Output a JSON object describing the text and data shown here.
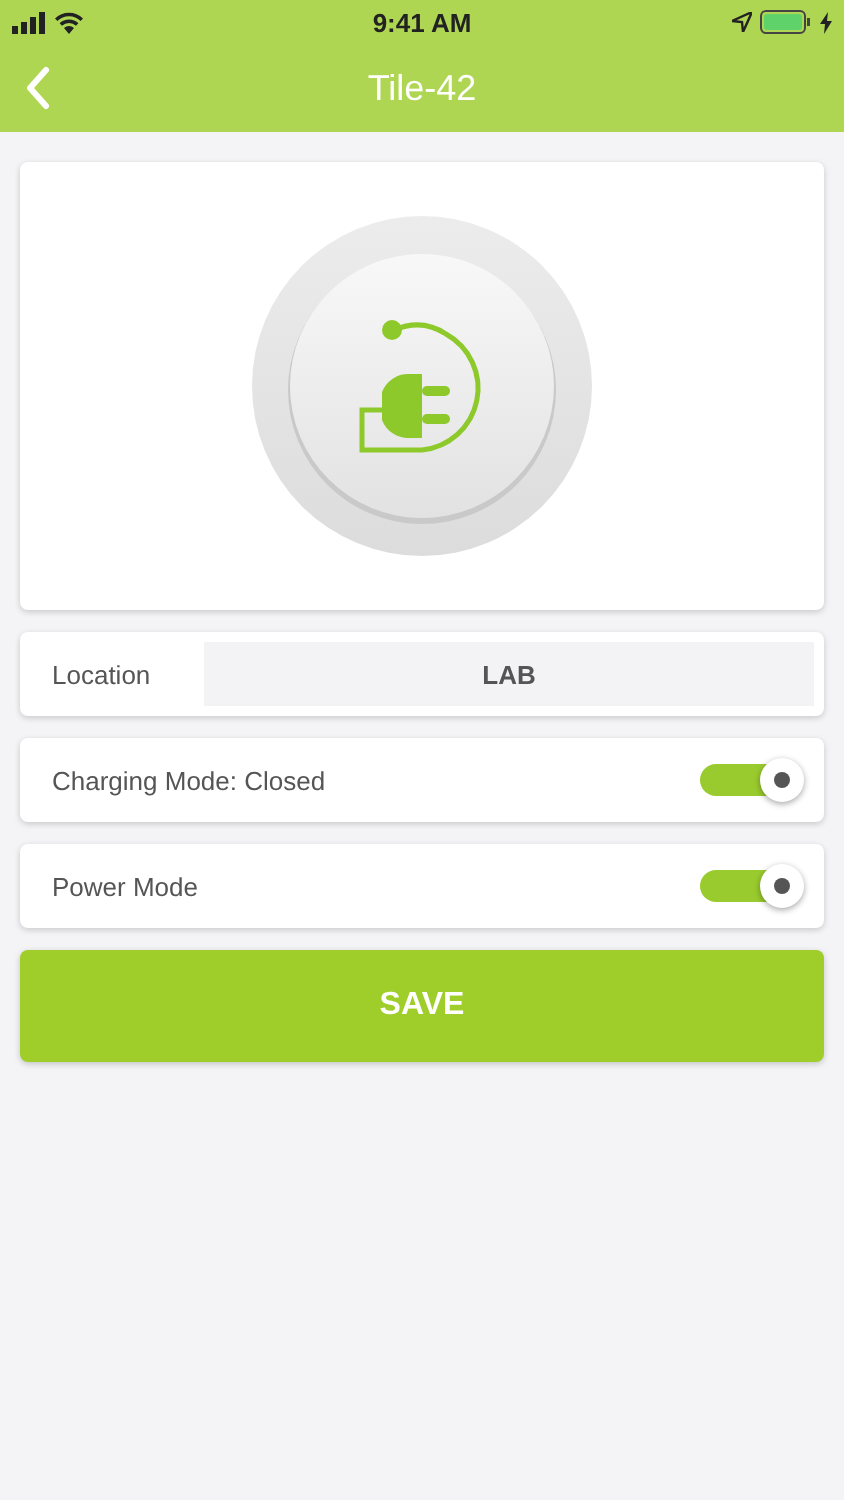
{
  "status_bar": {
    "time": "9:41 AM",
    "charging": true
  },
  "nav": {
    "title": "Tile-42"
  },
  "location": {
    "label": "Location",
    "value": "LAB"
  },
  "toggles": [
    {
      "label": "Charging Mode: Closed",
      "on": true
    },
    {
      "label": "Power Mode",
      "on": true
    }
  ],
  "save_button": "SAVE"
}
